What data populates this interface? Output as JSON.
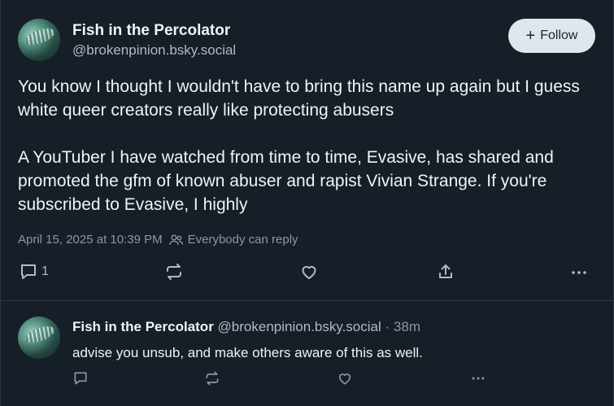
{
  "post": {
    "author_name": "Fish in the Percolator",
    "author_handle": "@brokenpinion.bsky.social",
    "follow_label": "Follow",
    "text": "You know I thought I wouldn't have to bring this name up again but I guess white queer creators really like protecting abusers\n\nA YouTuber I have watched from time to time, Evasive, has shared and promoted the gfm of known abuser and rapist Vivian Strange. If you're subscribed to Evasive, I highly",
    "timestamp": "April 15, 2025 at 10:39 PM",
    "reply_setting": "Everybody can reply",
    "reply_count": "1",
    "icons": [
      "reply-icon",
      "repost-icon",
      "like-icon",
      "share-icon",
      "more-icon"
    ]
  },
  "reply": {
    "author_name": "Fish in the Percolator",
    "author_handle": "@brokenpinion.bsky.social",
    "separator": "·",
    "time_ago": "38m",
    "text": "advise you unsub, and make others aware of this as well."
  },
  "colors": {
    "background": "#161e27",
    "text": "#f1f3f5",
    "muted": "#8b98a8",
    "follow_bg": "#dfe6ee"
  }
}
